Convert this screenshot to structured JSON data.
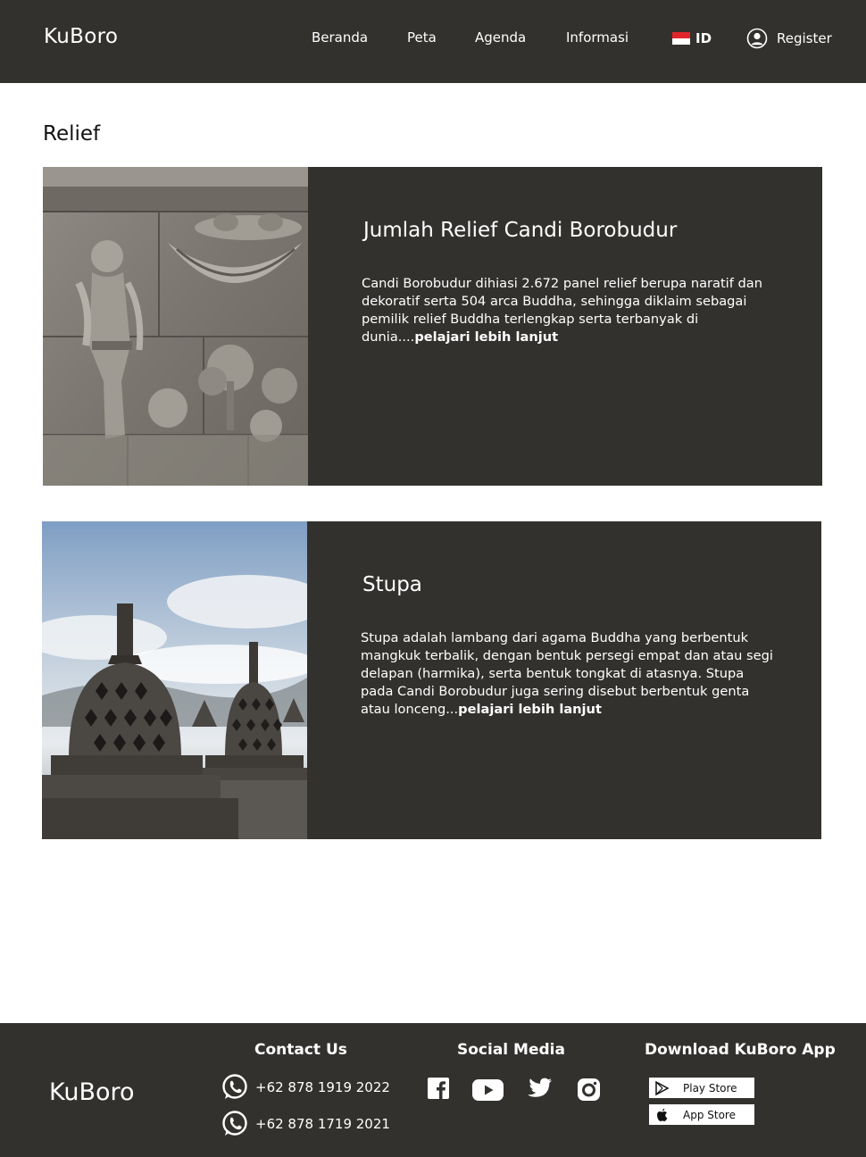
{
  "header": {
    "logo": "KuBoro",
    "nav": [
      "Beranda",
      "Peta",
      "Agenda",
      "Informasi"
    ],
    "lang": "ID",
    "register": "Register"
  },
  "page": {
    "title": "Relief"
  },
  "cards": [
    {
      "title": "Jumlah Relief Candi Borobudur",
      "text": "Candi Borobudur dihiasi 2.672 panel relief berupa naratif dan dekoratif serta 504 arca Buddha, sehingga diklaim sebagai pemilik relief Buddha terlengkap serta terbanyak di dunia....",
      "more": "pelajari lebih lanjut"
    },
    {
      "title": "Stupa",
      "text": "Stupa adalah lambang dari agama Buddha yang berbentuk mangkuk terbalik, dengan bentuk persegi empat dan atau segi delapan (harmika), serta bentuk tongkat di atasnya. Stupa pada Candi Borobudur juga sering disebut berbentuk genta atau lonceng...",
      "more": "pelajari lebih lanjut"
    }
  ],
  "footer": {
    "logo": "KuBoro",
    "contact_heading": "Contact Us",
    "phones": [
      "+62 878 1919 2022",
      "+62 878 1719 2021"
    ],
    "social_heading": "Social Media",
    "social_icons": [
      "facebook-icon",
      "youtube-icon",
      "twitter-icon",
      "instagram-icon"
    ],
    "download_heading": "Download KuBoro App",
    "stores": [
      "Play Store",
      "App Store"
    ]
  },
  "colors": {
    "dark": "#33312e",
    "background": "#ffffff",
    "text_light": "#ffffff"
  }
}
